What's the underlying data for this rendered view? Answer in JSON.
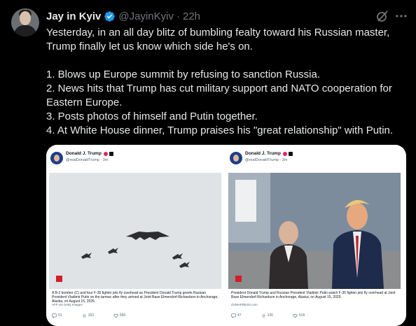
{
  "tweet": {
    "author": {
      "name": "Jay in Kyiv",
      "handle": "@JayinKyiv",
      "time": "22h"
    },
    "lines": [
      "Yesterday, in an all day blitz of bumbling fealty toward his Russian master, Trump finally let us know which side he's on.",
      "1. Blows up Europe summit by refusing to sanction Russia.",
      "2. News hits that Trump has cut military support and NATO cooperation for Eastern Europe.",
      "3. Posts photos of himself and Putin together.",
      "4. At White House dinner, Trump praises his \"great relationship\" with Putin."
    ]
  },
  "embedded_posts": [
    {
      "author": "Donald J. Trump",
      "handle": "@realDonaldTrump · 3m",
      "caption": "A B-2 bomber (C) and four F-35 fighter jets fly overhead as President Donald Trump greets Russian President Vladimir Putin on the tarmac after they arrived at Joint Base Elmendorf-Richardson in Anchorage, Alaska, on August 15, 2025.",
      "credit": "AFP via Getty Images",
      "replies": "51",
      "reposts": "153",
      "likes": "590"
    },
    {
      "author": "Donald J. Trump",
      "handle": "@realDonaldTrump · 3m",
      "caption": "President Donald Trump and Russian President Vladimir Putin watch F-35 fighter jets fly overhead at Joint Base Elmendorf-Richardson in Anchorage, Alaska, on August 15, 2025.",
      "credit": "ZUMAPRESS.com",
      "replies": "47",
      "reposts": "130",
      "likes": "516"
    }
  ],
  "colors": {
    "background": "#000000",
    "text": "#e7e9ea",
    "muted": "#71767b",
    "verified": "#1d9bf0"
  },
  "icons": [
    "verified-badge-icon",
    "grok-icon",
    "more-icon",
    "reply-icon",
    "repost-icon",
    "like-icon"
  ]
}
